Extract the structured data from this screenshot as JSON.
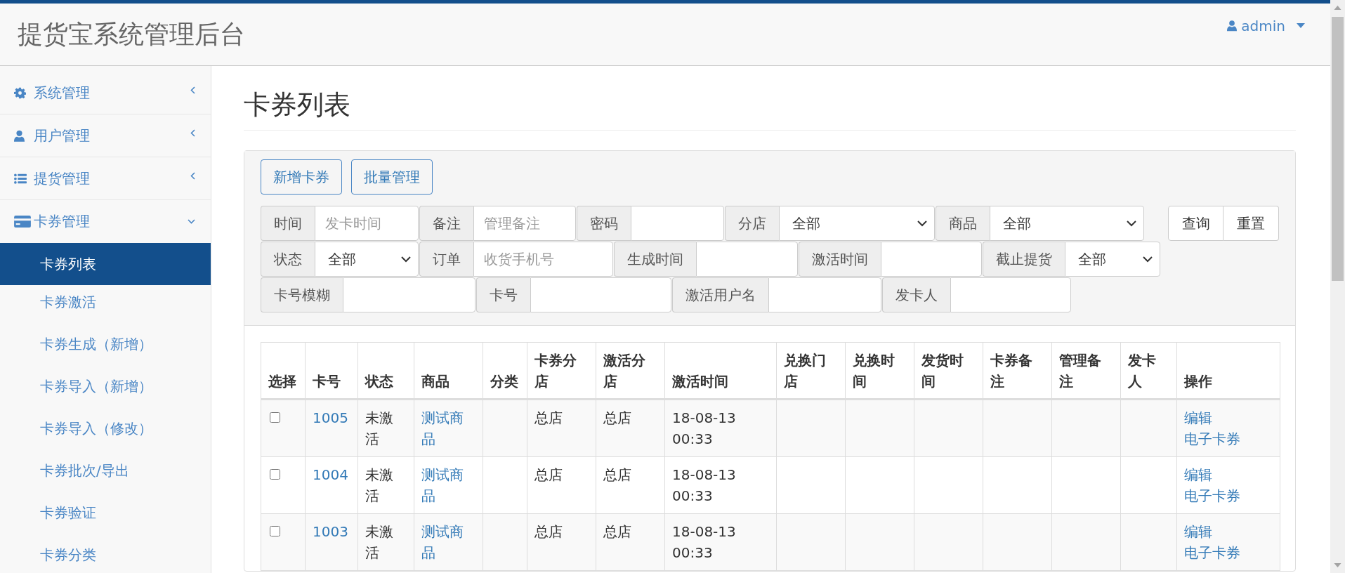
{
  "header": {
    "title": "提货宝系统管理后台",
    "user": "admin"
  },
  "sidebar": {
    "items": [
      {
        "label": "系统管理",
        "kind": "gear",
        "expanded": false
      },
      {
        "label": "用户管理",
        "kind": "user",
        "expanded": false
      },
      {
        "label": "提货管理",
        "kind": "list",
        "expanded": false
      },
      {
        "label": "卡券管理",
        "kind": "card",
        "expanded": true,
        "children": [
          {
            "label": "卡券列表",
            "selected": true
          },
          {
            "label": "卡券激活",
            "selected": false
          },
          {
            "label": "卡券生成（新增）",
            "selected": false
          },
          {
            "label": "卡券导入（新增）",
            "selected": false
          },
          {
            "label": "卡券导入（修改）",
            "selected": false
          },
          {
            "label": "卡券批次/导出",
            "selected": false
          },
          {
            "label": "卡券验证",
            "selected": false
          },
          {
            "label": "卡券分类",
            "selected": false
          }
        ]
      }
    ]
  },
  "page": {
    "heading": "卡券列表"
  },
  "toolbar": {
    "buttons": [
      "新增卡券",
      "批量管理"
    ]
  },
  "filters": {
    "rows": [
      [
        {
          "label": "时间",
          "kind": "text",
          "placeholder": "发卡时间"
        },
        {
          "label": "备注",
          "kind": "text",
          "placeholder": "管理备注"
        },
        {
          "label": "密码",
          "kind": "text"
        },
        {
          "label": "分店",
          "kind": "select",
          "value": "全部"
        },
        {
          "label": "商品",
          "kind": "select",
          "value": "全部"
        }
      ],
      [
        {
          "label": "状态",
          "kind": "select",
          "value": "全部"
        },
        {
          "label": "订单",
          "kind": "text",
          "placeholder": "收货手机号"
        },
        {
          "label": "生成时间",
          "kind": "text"
        },
        {
          "label": "激活时间",
          "kind": "text"
        },
        {
          "label": "截止提货",
          "kind": "select",
          "value": "全部"
        }
      ],
      [
        {
          "label": "卡号模糊",
          "kind": "text"
        },
        {
          "label": "卡号",
          "kind": "text"
        },
        {
          "label": "激活用户名",
          "kind": "text"
        },
        {
          "label": "发卡人",
          "kind": "text"
        }
      ]
    ],
    "actions": [
      "查询",
      "重置"
    ]
  },
  "table": {
    "columns": [
      "选择",
      "卡号",
      "状态",
      "商品",
      "分类",
      "卡券分店",
      "激活分店",
      "激活时间",
      "兑换门店",
      "兑换时间",
      "发货时间",
      "卡券备注",
      "管理备注",
      "发卡人",
      "操作"
    ],
    "rows": [
      {
        "checked": false,
        "card_no": "1005",
        "status": "未激活",
        "product": "测试商品",
        "card_store": "总店",
        "activation_store": "总店",
        "activation_time": "18-08-13 00:33",
        "actions": [
          "编辑",
          "电子卡券"
        ]
      },
      {
        "checked": false,
        "card_no": "1004",
        "status": "未激活",
        "product": "测试商品",
        "card_store": "总店",
        "activation_store": "总店",
        "activation_time": "18-08-13 00:33",
        "actions": [
          "编辑",
          "电子卡券"
        ]
      },
      {
        "checked": false,
        "card_no": "1003",
        "status": "未激活",
        "product": "测试商品",
        "card_store": "总店",
        "activation_store": "总店",
        "activation_time": "18-08-13 00:33",
        "actions": [
          "编辑",
          "电子卡券"
        ]
      }
    ]
  }
}
